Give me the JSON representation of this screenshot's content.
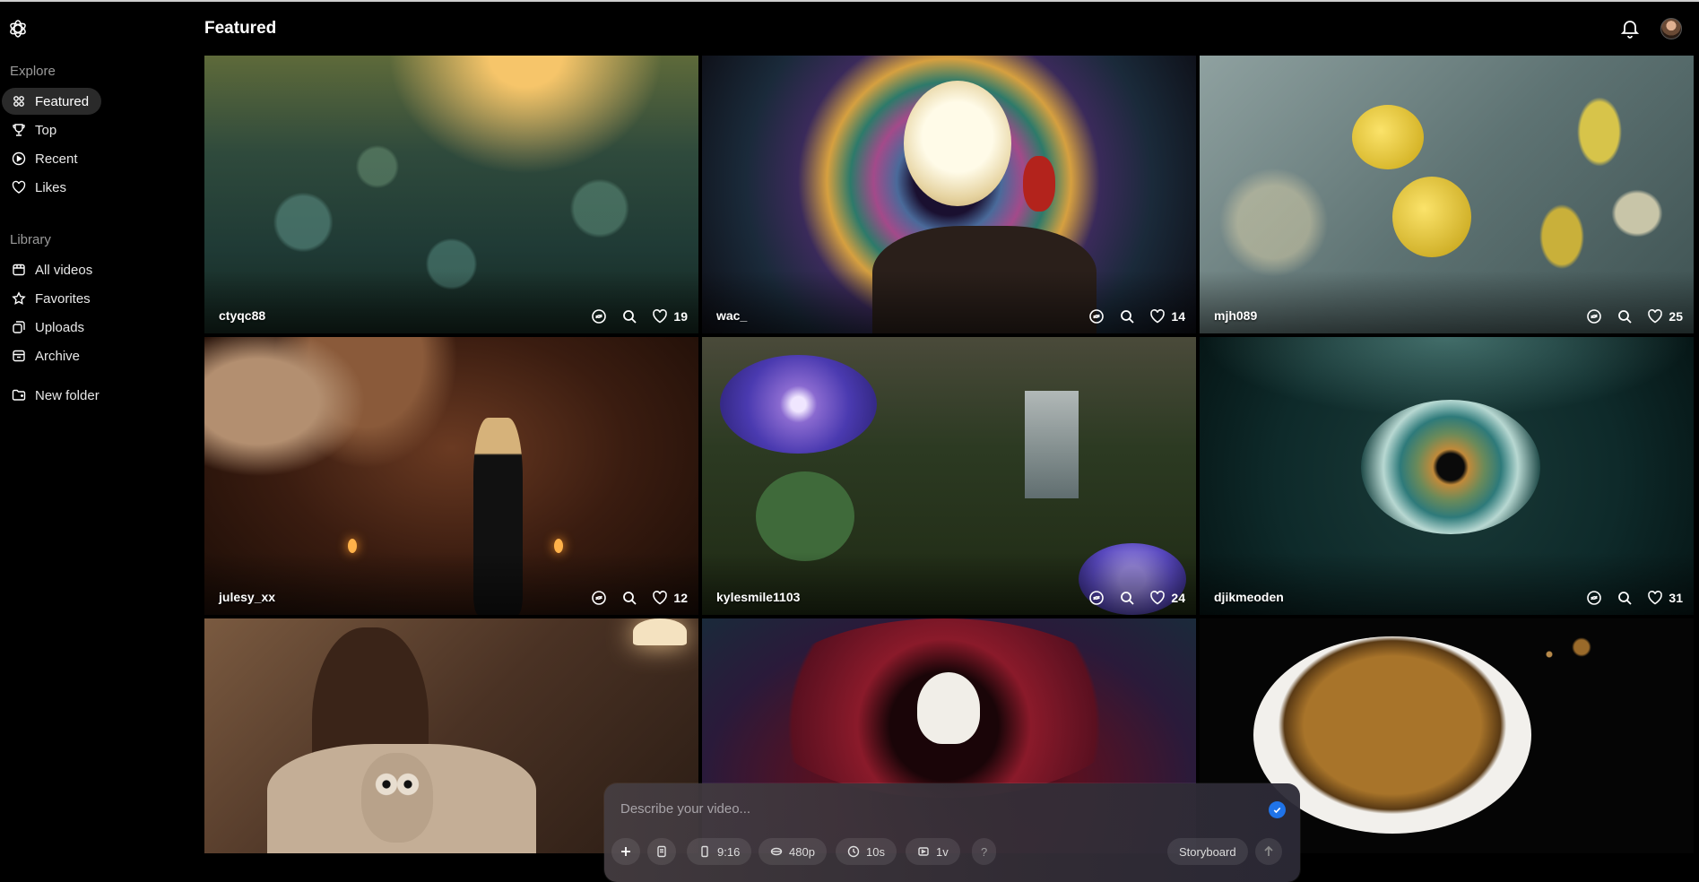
{
  "sidebar": {
    "explore_label": "Explore",
    "explore": [
      {
        "label": "Featured",
        "icon": "featured-icon",
        "active": true
      },
      {
        "label": "Top",
        "icon": "trophy-icon"
      },
      {
        "label": "Recent",
        "icon": "play-circle-icon"
      },
      {
        "label": "Likes",
        "icon": "heart-icon"
      }
    ],
    "library_label": "Library",
    "library": [
      {
        "label": "All videos",
        "icon": "video-grid-icon"
      },
      {
        "label": "Favorites",
        "icon": "star-icon"
      },
      {
        "label": "Uploads",
        "icon": "uploads-icon"
      },
      {
        "label": "Archive",
        "icon": "archive-icon"
      }
    ],
    "new_folder": "New folder"
  },
  "header": {
    "title": "Featured"
  },
  "videos": [
    {
      "user": "ctyqc88",
      "likes": "19"
    },
    {
      "user": "wac_",
      "likes": "14"
    },
    {
      "user": "mjh089",
      "likes": "25"
    },
    {
      "user": "julesy_xx",
      "likes": "12"
    },
    {
      "user": "kylesmile1103",
      "likes": "24"
    },
    {
      "user": "djikmeoden",
      "likes": "31"
    },
    {
      "user": "",
      "likes": ""
    },
    {
      "user": "",
      "likes": ""
    },
    {
      "user": "",
      "likes": ""
    }
  ],
  "composer": {
    "placeholder": "Describe your video...",
    "aspect": "9:16",
    "resolution": "480p",
    "duration": "10s",
    "variations": "1v",
    "help": "?",
    "storyboard": "Storyboard"
  },
  "colors": {
    "accent": "#1f73e8",
    "active_nav": "#2a2a2a"
  }
}
